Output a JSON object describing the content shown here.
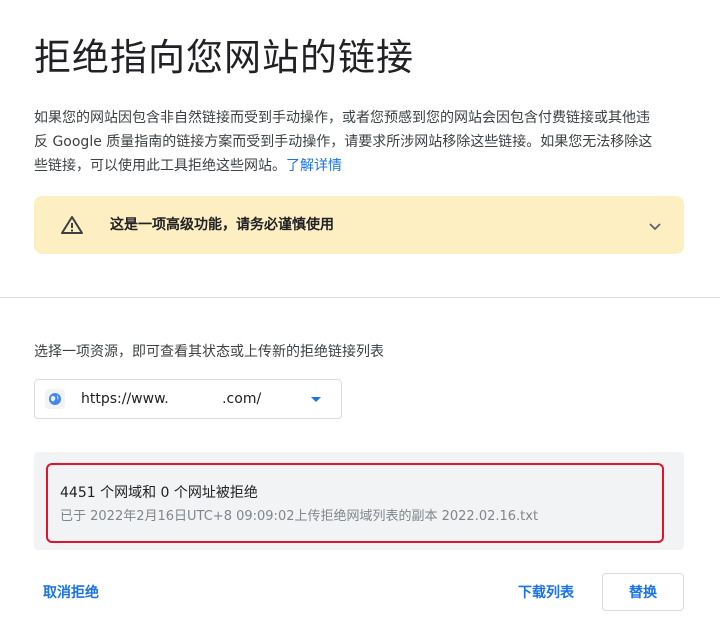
{
  "page": {
    "title": "拒绝指向您网站的链接",
    "intro_text": "如果您的网站因包含非自然链接而受到手动操作，或者您预感到您的网站会因包含付费链接或其他违反 Google 质量指南的链接方案而受到手动操作，请要求所涉网站移除这些链接。如果您无法移除这些链接，可以使用此工具拒绝这些网站。",
    "learn_more_link": "了解详情"
  },
  "warning": {
    "text": "这是一项高级功能，请务必谨慎使用",
    "icon": "warning-icon",
    "expand_icon": "chevron-down-icon",
    "background_color": "#feefc3"
  },
  "property_selector": {
    "label": "选择一项资源，即可查看其状态或上传新的拒绝链接列表",
    "selected_value": "https://www.            .com/",
    "icon": "globe-icon"
  },
  "status": {
    "summary": "4451 个网域和 0 个网址被拒绝",
    "detail": "已于 2022年2月16日UTC+8 09:09:02上传拒绝网域列表的副本 2022.02.16.txt",
    "highlight_color": "#e0142c"
  },
  "actions": {
    "cancel_label": "取消拒绝",
    "download_label": "下载列表",
    "replace_label": "替换"
  },
  "colors": {
    "accent": "#1a73e8"
  }
}
